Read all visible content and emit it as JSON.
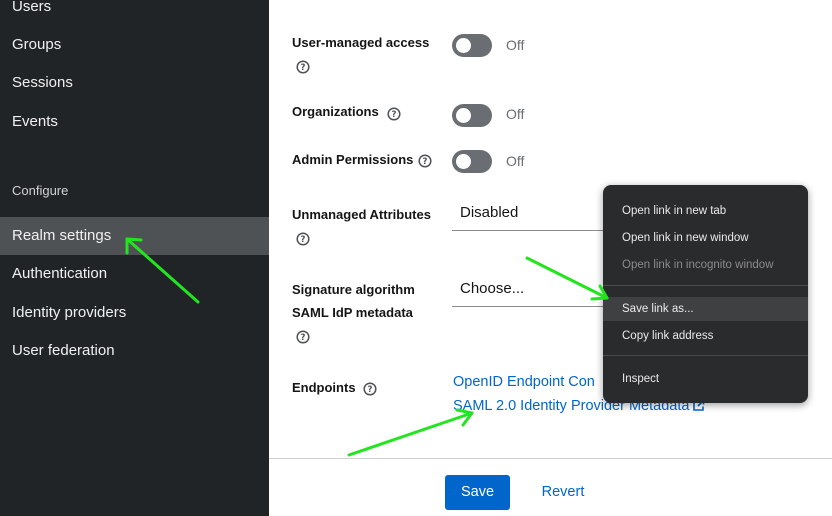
{
  "sidebar": {
    "items": [
      {
        "label": "Users"
      },
      {
        "label": "Groups"
      },
      {
        "label": "Sessions"
      },
      {
        "label": "Events"
      }
    ],
    "section_label": "Configure",
    "config_items": [
      {
        "label": "Realm settings"
      },
      {
        "label": "Authentication"
      },
      {
        "label": "Identity providers"
      },
      {
        "label": "User federation"
      }
    ]
  },
  "form": {
    "user_managed_access": {
      "label": "User-managed access",
      "state": "Off"
    },
    "organizations": {
      "label": "Organizations",
      "state": "Off"
    },
    "admin_permissions": {
      "label": "Admin Permissions",
      "state": "Off"
    },
    "unmanaged_attributes": {
      "label": "Unmanaged Attributes",
      "value": "Disabled"
    },
    "signature_algorithm": {
      "label_line1": "Signature algorithm",
      "label_line2": "SAML IdP metadata",
      "value": "Choose..."
    },
    "endpoints": {
      "label": "Endpoints",
      "link1": "OpenID Endpoint Con",
      "link2": "SAML 2.0 Identity Provider Metadata"
    }
  },
  "actions": {
    "save": "Save",
    "revert": "Revert"
  },
  "context_menu": {
    "items": [
      {
        "label": "Open link in new tab"
      },
      {
        "label": "Open link in new window"
      },
      {
        "label": "Open link in incognito window"
      },
      {
        "label": "Save link as..."
      },
      {
        "label": "Copy link address"
      },
      {
        "label": "Inspect"
      }
    ]
  },
  "colors": {
    "sidebar_bg": "#212427",
    "active_nav_bg": "#4f5255",
    "link": "#0066cc",
    "primary_button": "#0066cc",
    "context_menu_bg": "#2a2b2d",
    "annotation_arrow": "#22e51f"
  },
  "icons": [
    "help-circle-icon",
    "external-link-icon",
    "annotation-arrow"
  ]
}
